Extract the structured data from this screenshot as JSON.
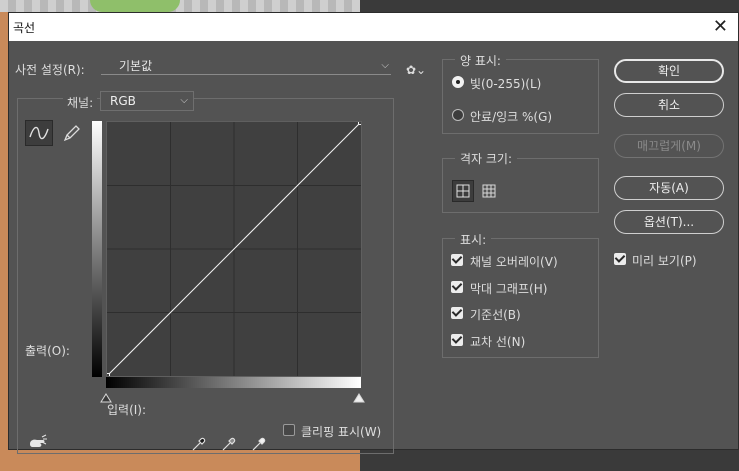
{
  "window": {
    "title": "곡선",
    "close_glyph": "✕"
  },
  "preset": {
    "label": "사전 설정(R):",
    "value": "기본값",
    "menu_icon": "gear-icon"
  },
  "channel": {
    "label": "채널:",
    "value": "RGB"
  },
  "graph": {
    "output_label": "출력(O):",
    "input_label": "입력(I):",
    "curve_points": [
      [
        0,
        0
      ],
      [
        255,
        255
      ]
    ],
    "tools": [
      "curve-tool-icon",
      "pencil-tool-icon"
    ]
  },
  "clipping": {
    "label": "클리핑 표시(W)",
    "checked": false
  },
  "show_amount": {
    "title": "양 표시:",
    "options": [
      {
        "label": "빛(0-255)(L)",
        "selected": true
      },
      {
        "label": "안료/잉크 %(G)",
        "selected": false
      }
    ]
  },
  "grid_size": {
    "title": "격자 크기:",
    "selected": "simple"
  },
  "show": {
    "title": "표시:",
    "options": [
      {
        "label": "채널 오버레이(V)",
        "checked": true
      },
      {
        "label": "막대 그래프(H)",
        "checked": true
      },
      {
        "label": "기준선(B)",
        "checked": true
      },
      {
        "label": "교차 선(N)",
        "checked": true
      }
    ]
  },
  "buttons": {
    "ok": "확인",
    "cancel": "취소",
    "smooth": "매끄럽게(M)",
    "auto": "자동(A)",
    "options": "옵션(T)..."
  },
  "preview": {
    "label": "미리 보기(P)",
    "checked": true
  },
  "colors": {
    "dialog_bg": "#535353",
    "graph_bg": "#404040",
    "accent": "#ffffff"
  }
}
